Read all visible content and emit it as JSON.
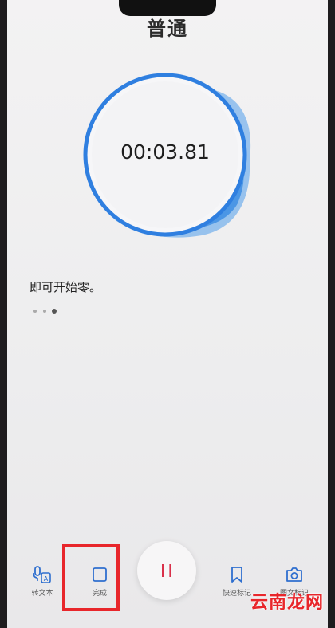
{
  "header": {
    "title": "普通"
  },
  "recorder": {
    "timer": "00:03.81"
  },
  "content": {
    "hint": "即可开始零。"
  },
  "pagination": {
    "count": 3,
    "active_index": 2
  },
  "toolbar": {
    "transcribe_label": "转文本",
    "finish_label": "完成",
    "quick_mark_label": "快速标记",
    "photo_mark_label": "图文标记"
  },
  "watermark": {
    "text": "云南龙网"
  },
  "colors": {
    "accent_blue": "#2f7fe0",
    "pause_red": "#d9304a",
    "highlight_red": "#e8262b"
  },
  "icons": {
    "transcribe": "transcribe-icon",
    "finish": "stop-square-icon",
    "pause": "pause-icon",
    "quick_mark": "bookmark-icon",
    "photo_mark": "camera-icon"
  }
}
